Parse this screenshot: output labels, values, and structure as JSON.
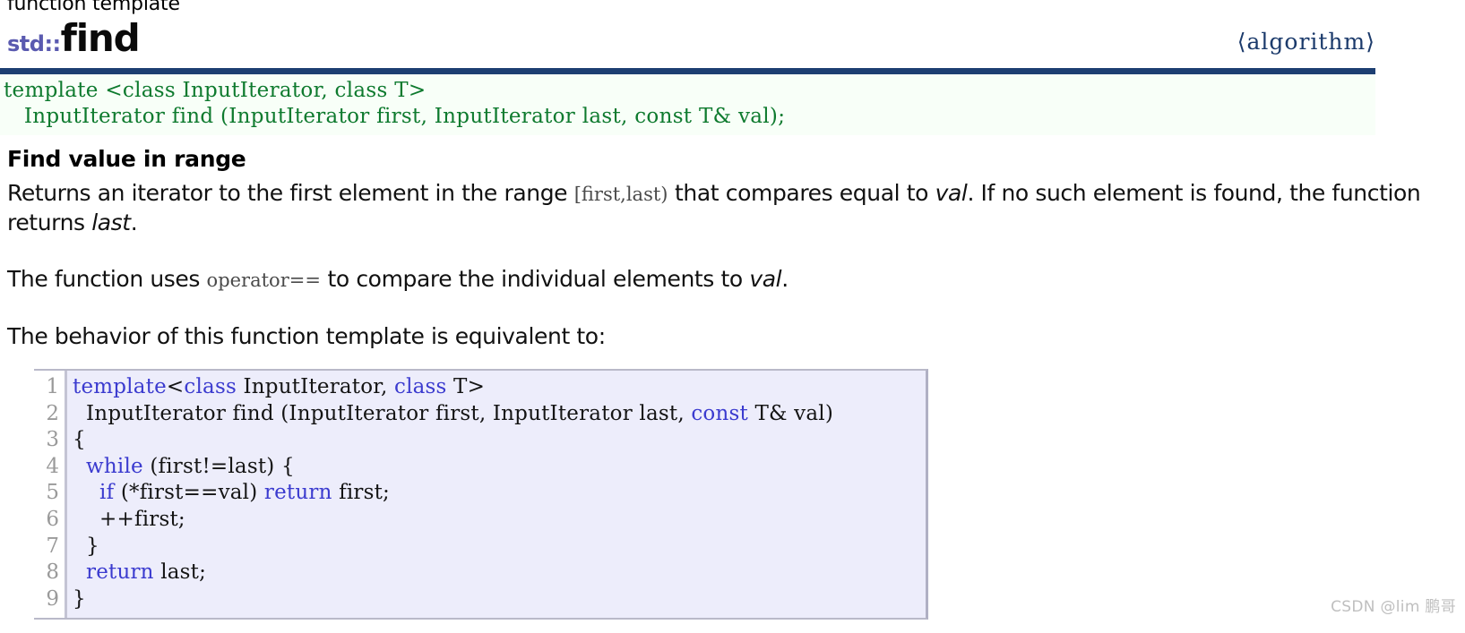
{
  "header": {
    "kicker": "function template",
    "namespace": "std::",
    "name": "find",
    "header_file": "⟨algorithm⟩",
    "rule_color": "#1d3f72",
    "namespace_color": "#5a5ab0",
    "header_file_color": "#1b3a6b"
  },
  "signature": {
    "line1": "template <class InputIterator, class T>",
    "line2": "   InputIterator find (InputIterator first, InputIterator last, const T& val);",
    "text_color": "#0e7a2e",
    "background": "#f8fff8"
  },
  "section": {
    "title": "Find value in range",
    "paragraph1": {
      "part1": "Returns an iterator to the first element in the range ",
      "code1": "[first,last)",
      "part2": " that compares equal to ",
      "em1": "val",
      "part3": ". If no such element is found, the function returns ",
      "em2": "last",
      "part4": "."
    },
    "paragraph2": {
      "part1": "The function uses ",
      "code1": "operator==",
      "part2": " to compare the individual elements to ",
      "em1": "val",
      "part3": "."
    },
    "paragraph3": "The behavior of this function template is equivalent to:"
  },
  "code_sample": {
    "background": "#ededfb",
    "keyword_color": "#3b3bcf",
    "linenumber_color": "#9a9a9a",
    "line_numbers": "1\n2\n3\n4\n5\n6\n7\n8\n9",
    "lines": [
      {
        "n": "1",
        "segments": [
          {
            "t": "template",
            "k": true
          },
          {
            "t": "<",
            "k": false
          },
          {
            "t": "class",
            "k": true
          },
          {
            "t": " InputIterator, ",
            "k": false
          },
          {
            "t": "class",
            "k": true
          },
          {
            "t": " T>",
            "k": false
          }
        ]
      },
      {
        "n": "2",
        "segments": [
          {
            "t": "  InputIterator find (InputIterator first, InputIterator last, ",
            "k": false
          },
          {
            "t": "const",
            "k": true
          },
          {
            "t": " T& val)",
            "k": false
          }
        ]
      },
      {
        "n": "3",
        "segments": [
          {
            "t": "{",
            "k": false
          }
        ]
      },
      {
        "n": "4",
        "segments": [
          {
            "t": "  ",
            "k": false
          },
          {
            "t": "while",
            "k": true
          },
          {
            "t": " (first!=last) {",
            "k": false
          }
        ]
      },
      {
        "n": "5",
        "segments": [
          {
            "t": "    ",
            "k": false
          },
          {
            "t": "if",
            "k": true
          },
          {
            "t": " (*first==val) ",
            "k": false
          },
          {
            "t": "return",
            "k": true
          },
          {
            "t": " first;",
            "k": false
          }
        ]
      },
      {
        "n": "6",
        "segments": [
          {
            "t": "    ++first;",
            "k": false
          }
        ]
      },
      {
        "n": "7",
        "segments": [
          {
            "t": "  }",
            "k": false
          }
        ]
      },
      {
        "n": "8",
        "segments": [
          {
            "t": "  ",
            "k": false
          },
          {
            "t": "return",
            "k": true
          },
          {
            "t": " last;",
            "k": false
          }
        ]
      },
      {
        "n": "9",
        "segments": [
          {
            "t": "}",
            "k": false
          }
        ]
      }
    ]
  },
  "watermark": "CSDN @lim 鹏哥"
}
